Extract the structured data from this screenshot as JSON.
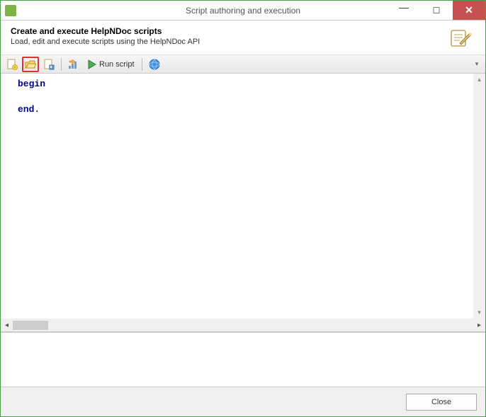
{
  "window": {
    "title": "Script authoring and execution"
  },
  "header": {
    "title": "Create and execute HelpNDoc scripts",
    "subtitle": "Load, edit and execute scripts using the HelpNDoc API"
  },
  "toolbar": {
    "new_name": "new-script-icon",
    "open_name": "open-script-icon",
    "save_name": "save-script-icon",
    "build_name": "build-icon",
    "run_name": "run-icon",
    "run_label": "Run script",
    "help_name": "help-icon"
  },
  "editor": {
    "line1_keyword": "begin",
    "line2_blank": "",
    "line3_keyword": "end",
    "line3_suffix": "."
  },
  "footer": {
    "close_label": "Close"
  }
}
